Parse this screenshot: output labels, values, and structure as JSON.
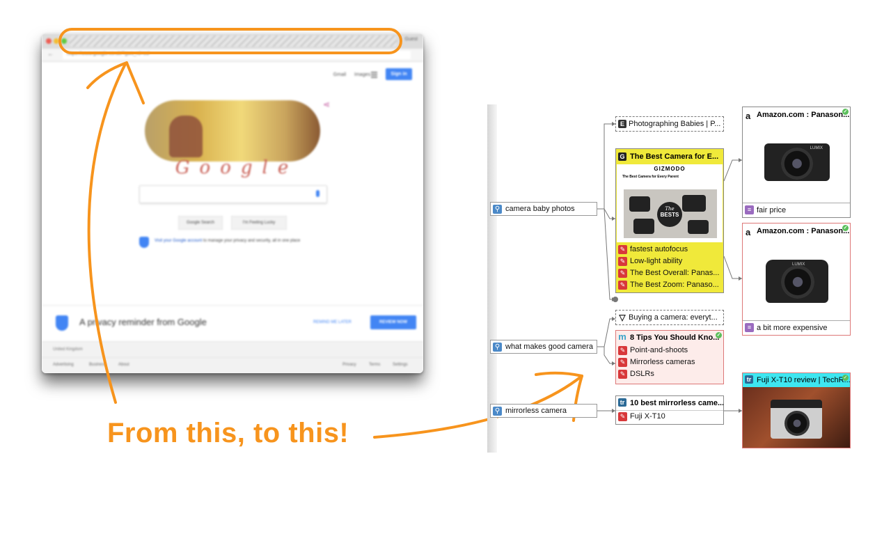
{
  "caption": "From this, to this!",
  "browser": {
    "guest": "Guest",
    "url": "https://www.google.co.uk/?gws_rd=ssl",
    "top_links": [
      "Gmail",
      "Images"
    ],
    "sign_in": "Sign in",
    "doodle_word": "Google",
    "buttons": [
      "Google Search",
      "I'm Feeling Lucky"
    ],
    "privacy_link": "Visit your Google account",
    "privacy_text": " to manage your privacy and security, all in one place",
    "reminder_text": "A privacy reminder from Google",
    "remind_later": "REMIND ME LATER",
    "review_now": "REVIEW NOW",
    "country": "United Kingdom",
    "footer_left": [
      "Advertising",
      "Business",
      "About"
    ],
    "footer_right": [
      "Privacy",
      "Terms",
      "Settings"
    ]
  },
  "map": {
    "queries": [
      {
        "label": "camera baby photos"
      },
      {
        "label": "what makes good camera"
      },
      {
        "label": "mirrorless camera"
      }
    ],
    "pages": {
      "photographing": {
        "title": "Photographing Babies | P...",
        "icon": "E"
      },
      "gizmodo": {
        "title": "The Best Camera for E...",
        "icon": "G",
        "header": "GIZMODO",
        "sub": "The Best Camera for Every Parent",
        "badge_top": "The",
        "badge": "BESTS",
        "items": [
          "fastest autofocus",
          "Low-light ability",
          "The Best Overall: Panas...",
          "The Best Zoom: Panaso..."
        ],
        "highlight_color": "#f0e93a"
      },
      "buying": {
        "title": "Buying a camera: everyt...",
        "icon": "▽"
      },
      "tips": {
        "title": "8 Tips You Should Kno...",
        "icon": "m",
        "items": [
          "Point-and-shoots",
          "Mirrorless cameras",
          "DSLRs"
        ],
        "bg": "#fdecea"
      },
      "mirrorless": {
        "title": "10 best mirrorless came...",
        "icon": "tr",
        "items": [
          "Fuji X-T10"
        ]
      }
    },
    "products": [
      {
        "title": "Amazon.com : Panason...",
        "note": "fair price"
      },
      {
        "title": "Amazon.com : Panason...",
        "note": "a bit more expensive"
      },
      {
        "title": "Fuji X-T10 review | TechR...",
        "icon": "tr",
        "title_bg": "#3ee6f0"
      }
    ],
    "camera_brand": "LUMIX"
  }
}
